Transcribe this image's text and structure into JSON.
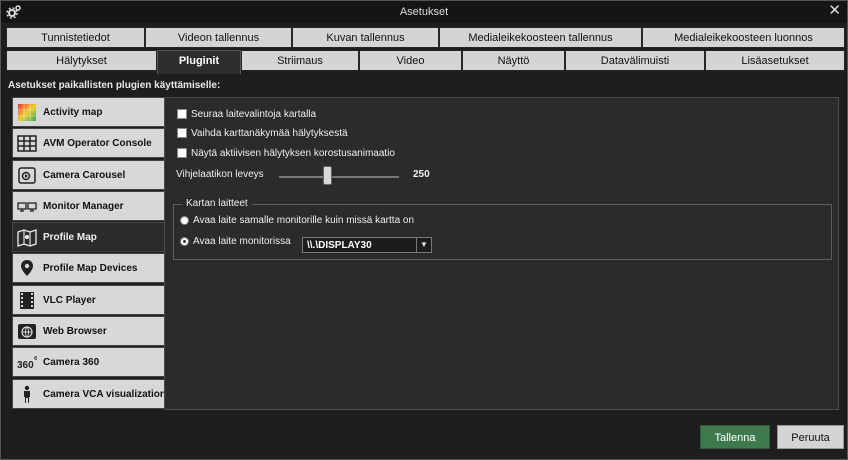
{
  "window": {
    "title": "Asetukset"
  },
  "tabs_row1": [
    {
      "label": "Tunnistetiedot"
    },
    {
      "label": "Videon tallennus"
    },
    {
      "label": "Kuvan tallennus"
    },
    {
      "label": "Medialeikekoosteen tallennus"
    },
    {
      "label": "Medialeikekoosteen luonnos"
    }
  ],
  "tabs_row2": [
    {
      "label": "Hälytykset"
    },
    {
      "label": "Pluginit"
    },
    {
      "label": "Striimaus"
    },
    {
      "label": "Video"
    },
    {
      "label": "Näyttö"
    },
    {
      "label": "Datavälimuisti"
    },
    {
      "label": "Lisäasetukset"
    }
  ],
  "active_tab": "Pluginit",
  "header_label": "Asetukset paikallisten plugien käyttämiselle:",
  "plugins": [
    {
      "label": "Activity map",
      "icon": "activity-map-icon"
    },
    {
      "label": "AVM Operator Console",
      "icon": "operator-console-icon"
    },
    {
      "label": "Camera Carousel",
      "icon": "camera-carousel-icon"
    },
    {
      "label": "Monitor Manager",
      "icon": "monitor-manager-icon"
    },
    {
      "label": "Profile Map",
      "icon": "profile-map-icon"
    },
    {
      "label": "Profile Map Devices",
      "icon": "map-pin-icon"
    },
    {
      "label": "VLC Player",
      "icon": "film-strip-icon"
    },
    {
      "label": "Web Browser",
      "icon": "globe-icon"
    },
    {
      "label": "Camera 360",
      "icon": "camera-360-icon"
    },
    {
      "label": "Camera VCA visualization",
      "icon": "person-icon"
    }
  ],
  "selected_plugin": "Profile Map",
  "settings": {
    "checkbox1": "Seuraa laitevalintoja kartalla",
    "checkbox2": "Vaihda karttanäkymää hälytyksestä",
    "checkbox3": "Näytä aktiivisen hälytyksen korostusanimaatio",
    "slider_label": "Vihjelaatikon leveys",
    "slider_value": "250",
    "group_title": "Kartan laitteet",
    "radio1": "Avaa laite samalle monitorille kuin missä kartta on",
    "radio2": "Avaa laite monitorissa",
    "monitor_select": "\\\\.\\DISPLAY30"
  },
  "buttons": {
    "save": "Tallenna",
    "cancel": "Peruuta"
  },
  "colors": {
    "accent_green": "#3f7a4f",
    "background": "#1e1e1e",
    "panel": "#2b2b2b"
  }
}
